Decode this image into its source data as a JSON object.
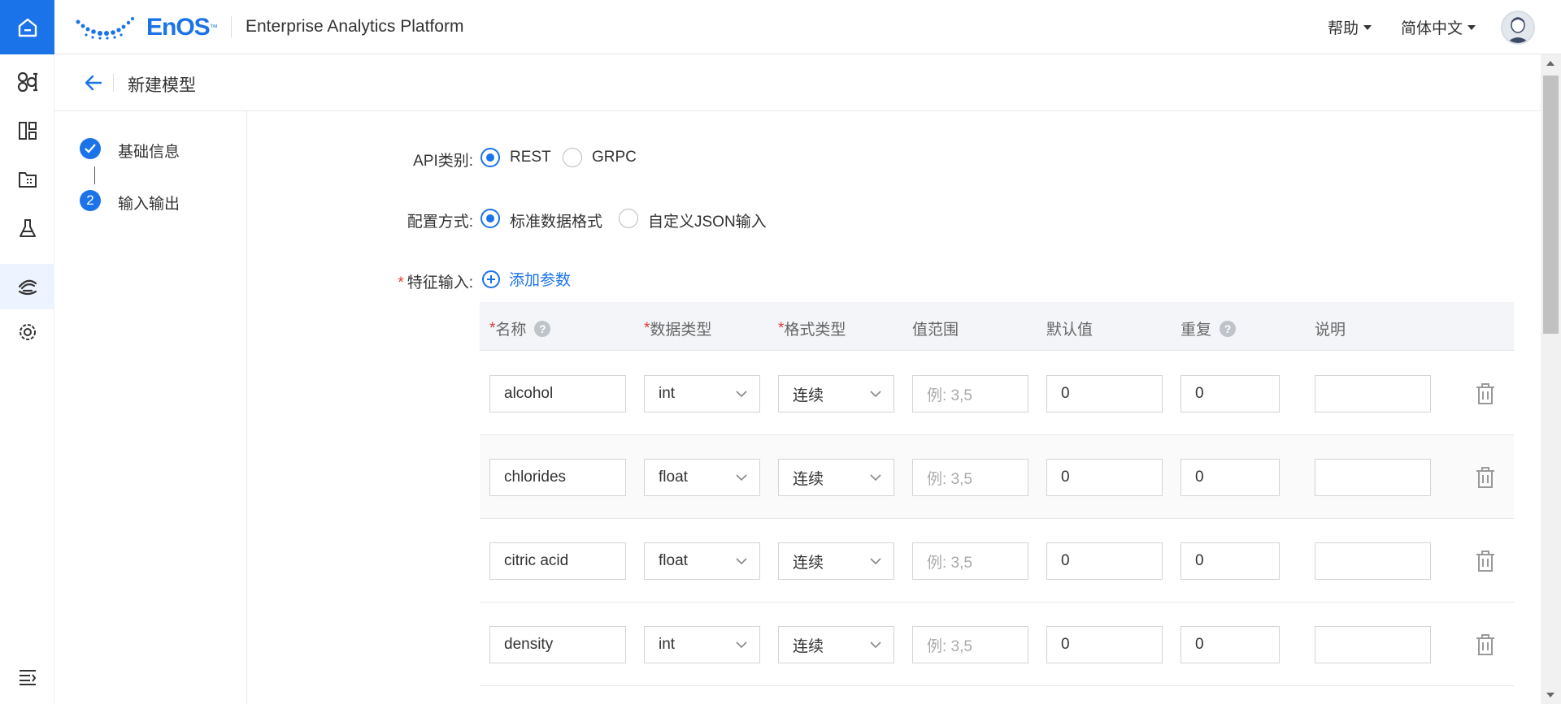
{
  "app": {
    "brand": "EnOS",
    "brand_tm": "™",
    "platform_title": "Enterprise Analytics Platform",
    "help_label": "帮助",
    "language_label": "简体中文"
  },
  "page": {
    "title": "新建模型"
  },
  "steps": [
    {
      "index": "1",
      "label": "基础信息",
      "status": "done"
    },
    {
      "index": "2",
      "label": "输入输出",
      "status": "current"
    }
  ],
  "form": {
    "api_type": {
      "label": "API类别:",
      "options": [
        "REST",
        "GRPC"
      ],
      "selected": "REST"
    },
    "config_mode": {
      "label": "配置方式:",
      "options": [
        "标准数据格式",
        "自定义JSON输入"
      ],
      "selected": "标准数据格式"
    },
    "feature_input": {
      "required_mark": "*",
      "label": "特征输入:",
      "add_param_label": "添加参数"
    }
  },
  "table": {
    "headers": {
      "name": "名称",
      "data_type": "数据类型",
      "format_type": "格式类型",
      "value_range": "值范围",
      "default_value": "默认值",
      "repeat": "重复",
      "description": "说明"
    },
    "required_mark": "*",
    "help_glyph": "?",
    "range_placeholder": "例: 3,5",
    "rows": [
      {
        "name": "alcohol",
        "data_type": "int",
        "format_type": "连续",
        "value_range": "",
        "default_value": "0",
        "repeat": "0",
        "description": ""
      },
      {
        "name": "chlorides",
        "data_type": "float",
        "format_type": "连续",
        "value_range": "",
        "default_value": "0",
        "repeat": "0",
        "description": ""
      },
      {
        "name": "citric acid",
        "data_type": "float",
        "format_type": "连续",
        "value_range": "",
        "default_value": "0",
        "repeat": "0",
        "description": ""
      },
      {
        "name": "density",
        "data_type": "int",
        "format_type": "连续",
        "value_range": "",
        "default_value": "0",
        "repeat": "0",
        "description": ""
      }
    ]
  },
  "colors": {
    "primary": "#1a73e8",
    "required": "#e53935"
  },
  "icons": {
    "home": "home-icon",
    "back": "arrow-left-icon",
    "check": "check-icon",
    "trash": "trash-icon",
    "add": "plus-circle-icon"
  }
}
